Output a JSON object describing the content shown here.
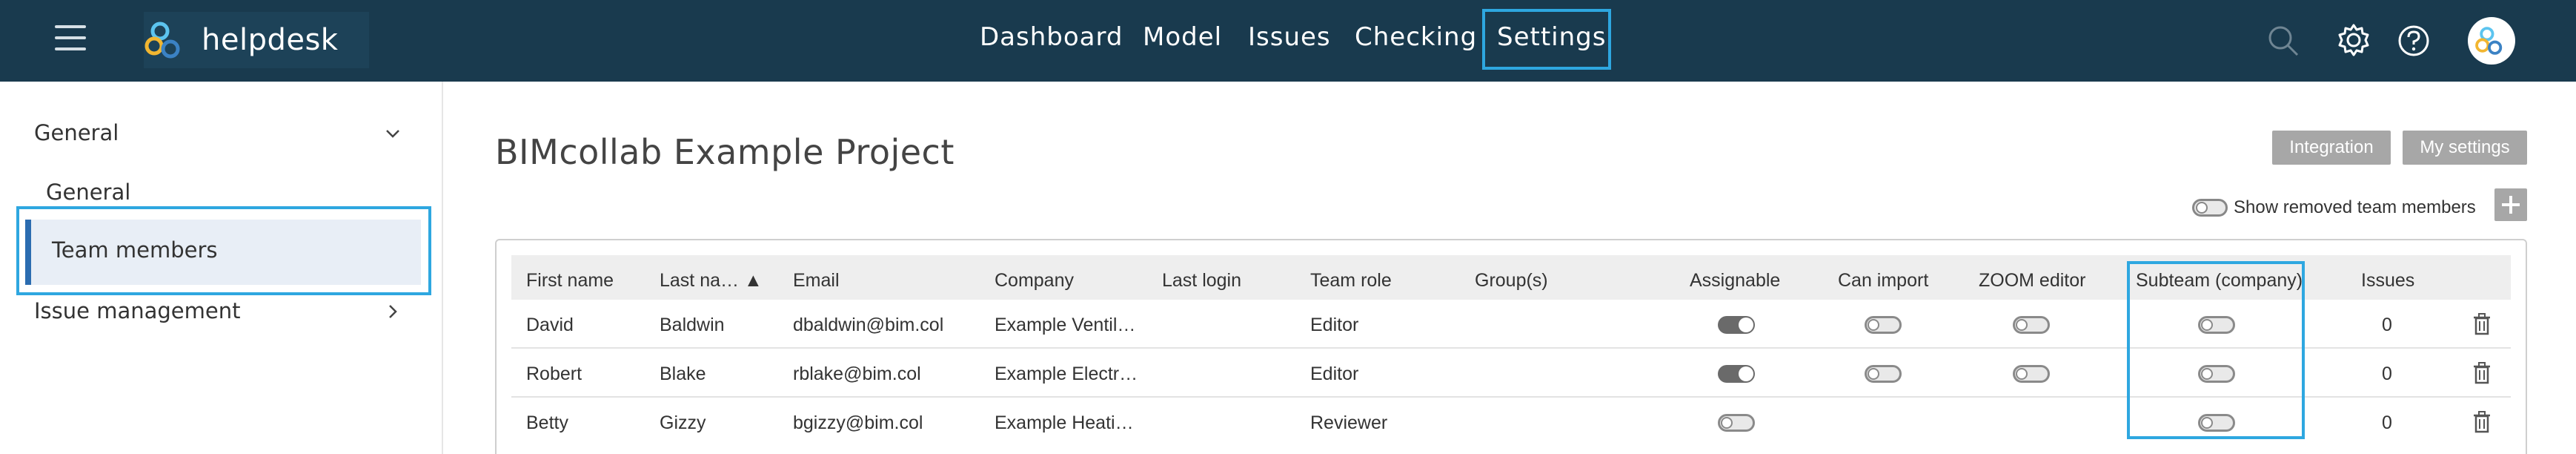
{
  "topbar": {
    "brand": "helpdesk",
    "nav": [
      {
        "label": "Dashboard"
      },
      {
        "label": "Model"
      },
      {
        "label": "Issues"
      },
      {
        "label": "Checking"
      },
      {
        "label": "Settings",
        "selected": true
      }
    ],
    "icons": [
      "menu-icon",
      "search-icon",
      "gear-icon",
      "help-icon",
      "avatar"
    ]
  },
  "sidebar": {
    "section": "General",
    "items": [
      {
        "label": "General"
      },
      {
        "label": "Team members",
        "active": true
      },
      {
        "label": "Issue management"
      }
    ]
  },
  "main": {
    "title": "BIMcollab Example Project",
    "buttons": {
      "integration": "Integration",
      "my_settings": "My settings"
    },
    "show_removed_label": "Show removed team members",
    "show_removed_on": false
  },
  "table": {
    "columns": [
      "First name",
      "Last na… ▲",
      "Email",
      "Company",
      "Last login",
      "Team role",
      "Group(s)",
      "Assignable",
      "Can import",
      "ZOOM editor",
      "Subteam (company)",
      "Issues"
    ],
    "rows": [
      {
        "first": "David",
        "last": "Baldwin",
        "email": "dbaldwin@bim.col",
        "company": "Example Ventil…",
        "last_login": "",
        "role": "Editor",
        "groups": "",
        "assignable": true,
        "can_import": false,
        "zoom_editor": false,
        "subteam": false,
        "issues": "0"
      },
      {
        "first": "Robert",
        "last": "Blake",
        "email": "rblake@bim.col",
        "company": "Example Electr…",
        "last_login": "",
        "role": "Editor",
        "groups": "",
        "assignable": true,
        "can_import": false,
        "zoom_editor": false,
        "subteam": false,
        "issues": "0"
      },
      {
        "first": "Betty",
        "last": "Gizzy",
        "email": "bgizzy@bim.col",
        "company": "Example Heati…",
        "last_login": "",
        "role": "Reviewer",
        "groups": "",
        "assignable": false,
        "can_import": null,
        "zoom_editor": null,
        "subteam": false,
        "issues": "0"
      }
    ]
  },
  "colors": {
    "topbar": "#193a4e",
    "highlight": "#2ea7e0",
    "active_bg": "#e8eef6",
    "active_bar": "#2b6cb0",
    "grey_button": "#a7a7a7"
  }
}
